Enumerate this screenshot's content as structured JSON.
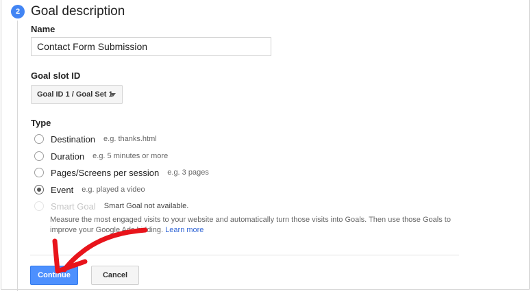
{
  "step": {
    "number": "2",
    "title": "Goal description"
  },
  "name_field": {
    "label": "Name",
    "value": "Contact Form Submission"
  },
  "goal_slot": {
    "label": "Goal slot ID",
    "selected": "Goal ID 1 / Goal Set 1"
  },
  "type": {
    "label": "Type",
    "options": [
      {
        "label": "Destination",
        "hint": "e.g. thanks.html",
        "checked": false,
        "disabled": false
      },
      {
        "label": "Duration",
        "hint": "e.g. 5 minutes or more",
        "checked": false,
        "disabled": false
      },
      {
        "label": "Pages/Screens per session",
        "hint": "e.g. 3 pages",
        "checked": false,
        "disabled": false
      },
      {
        "label": "Event",
        "hint": "e.g. played a video",
        "checked": true,
        "disabled": false
      },
      {
        "label": "Smart Goal",
        "hint": "Smart Goal not available.",
        "checked": false,
        "disabled": true
      }
    ],
    "smart_goal_description": "Measure the most engaged visits to your website and automatically turn those visits into Goals. Then use those Goals to improve your Google Ads bidding.",
    "learn_more": "Learn more"
  },
  "buttons": {
    "continue": "Continue",
    "cancel": "Cancel"
  },
  "colors": {
    "accent": "#4285f4",
    "continue_bg": "#4d90fe",
    "arrow": "#e8141b"
  }
}
